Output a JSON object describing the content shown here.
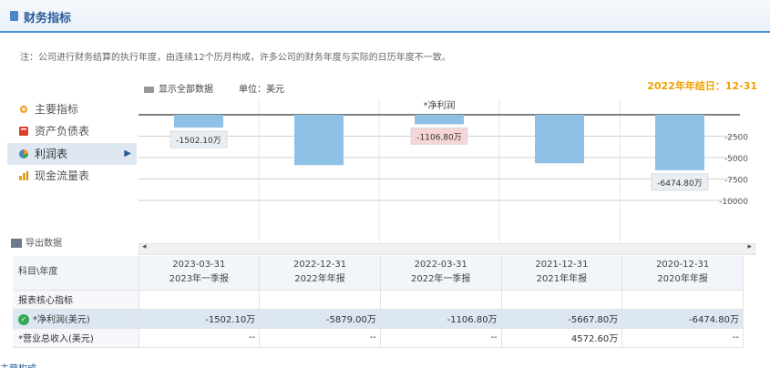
{
  "header": {
    "title": "财务指标"
  },
  "note": "注：公司进行财务结算的执行年度，由连续12个历月构成，许多公司的财务年度与实际的日历年度不一致。",
  "fiscal_year_end": "2022年年结日：12-31",
  "toolbar": {
    "show_all": "显示全部数据",
    "unit": "单位：美元"
  },
  "sidebar": {
    "items": [
      {
        "label": "主要指标",
        "icon": "sun-icon",
        "color": "#f59b1c"
      },
      {
        "label": "资产负债表",
        "icon": "book-icon",
        "color": "#d9412c"
      },
      {
        "label": "利润表",
        "icon": "pie-icon",
        "color": "#4a86c8",
        "active": true,
        "arrow": "▶"
      },
      {
        "label": "现金流量表",
        "icon": "chart-icon",
        "color": "#e6a817"
      }
    ],
    "export": "导出数据"
  },
  "chart_data": {
    "type": "bar",
    "title": "*净利润",
    "categories": [
      "2023-03-31",
      "2022-12-31",
      "2022-03-31",
      "2021-12-31",
      "2020-12-31"
    ],
    "values": [
      -1502.1,
      -5879.0,
      -1106.8,
      -5667.8,
      -6474.8
    ],
    "data_labels": [
      "-1502.10万",
      "",
      "-1106.80万",
      "",
      "-6474.80万"
    ],
    "yticks": [
      "-2500",
      "-5000",
      "-7500",
      "-10000"
    ],
    "ylim": [
      -10000,
      0
    ],
    "bar_color": "#8fc1e6",
    "label_colors": [
      "#e9eef3",
      "",
      "#f5d5d5",
      "",
      "#e9eef3"
    ]
  },
  "scrollbar": {
    "left": "◂",
    "right": "▸"
  },
  "table": {
    "header_label": "科目\\年度",
    "columns": [
      {
        "date": "2023-03-31",
        "period": "2023年一季报"
      },
      {
        "date": "2022-12-31",
        "period": "2022年年报"
      },
      {
        "date": "2022-03-31",
        "period": "2022年一季报"
      },
      {
        "date": "2021-12-31",
        "period": "2021年年报"
      },
      {
        "date": "2020-12-31",
        "period": "2020年年报"
      }
    ],
    "section": "报表核心指标",
    "rows": [
      {
        "label": "*净利润(美元)",
        "values": [
          "-1502.10万",
          "-5879.00万",
          "-1106.80万",
          "-5667.80万",
          "-6474.80万"
        ],
        "selected": true
      },
      {
        "label": "*营业总收入(美元)",
        "values": [
          "--",
          "--",
          "--",
          "4572.60万",
          "--"
        ]
      }
    ]
  },
  "bottom_link": "主营构成"
}
